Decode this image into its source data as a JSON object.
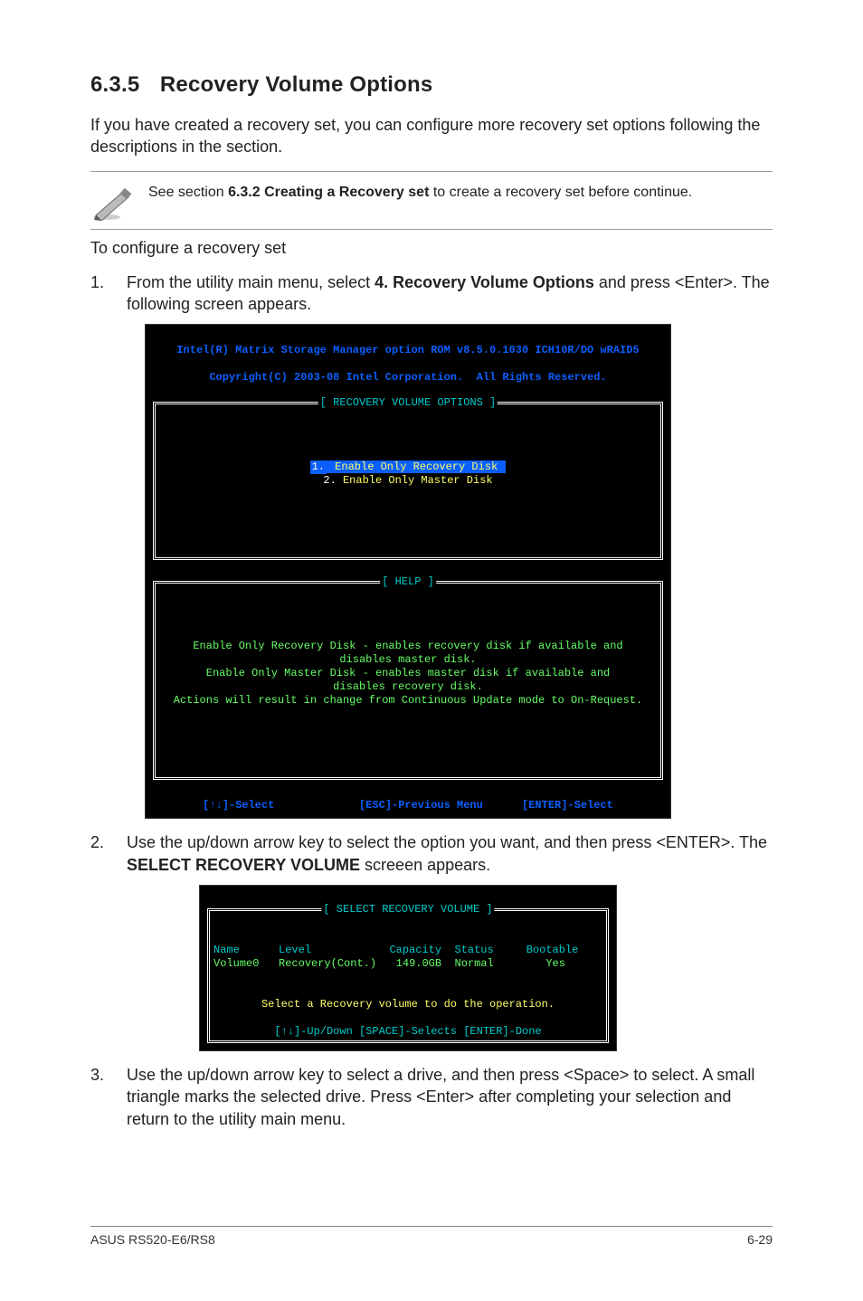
{
  "section": {
    "number": "6.3.5",
    "title": "Recovery Volume Options"
  },
  "intro": "If you have created a recovery set, you can configure more recovery set options following the descriptions in the section.",
  "note": {
    "pre": "See section ",
    "bold": "6.3.2 Creating a Recovery set",
    "post": " to create a recovery set before continue."
  },
  "after_note": "To configure a recovery set",
  "steps": {
    "s1": {
      "num": "1.",
      "pre": "From the utility main menu, select ",
      "bold": "4. Recovery Volume Options",
      "post": " and press <Enter>. The following screen appears."
    },
    "s2": {
      "num": "2.",
      "pre": "Use the up/down arrow key to select the option you want, and then press <ENTER>. The ",
      "bold": "SELECT RECOVERY VOLUME",
      "post": " screeen appears."
    },
    "s3": {
      "num": "3.",
      "text": "Use the up/down arrow key to select a drive, and then press <Space> to select. A small triangle marks the selected drive. Press <Enter> after completing your selection and return to the utility main menu."
    }
  },
  "term1": {
    "title1": "Intel(R) Matrix Storage Manager option ROM v8.5.0.1030 ICH10R/DO wRAID5",
    "title2": "Copyright(C) 2003-08 Intel Corporation.  All Rights Reserved.",
    "box1_title": "[ RECOVERY VOLUME OPTIONS ]",
    "opt1_num": "1.",
    "opt1_label": " Enable Only Recovery Disk ",
    "opt2_num": "2.",
    "opt2_label": " Enable Only Master Disk",
    "help_title": "[ HELP ]",
    "help_l1": "Enable Only Recovery Disk - enables recovery disk if available and",
    "help_l2": "disables master disk.",
    "help_l3": "Enable Only Master Disk - enables master disk if available and",
    "help_l4": "disables recovery disk.",
    "help_l5": "Actions will result in change from Continuous Update mode to On-Request.",
    "bottom_bar": "[↑↓]-Select             [ESC]-Previous Menu      [ENTER]-Select"
  },
  "term2": {
    "box_title": "[ SELECT RECOVERY VOLUME ]",
    "hdr_name": "Name",
    "hdr_level": "Level",
    "hdr_cap": "Capacity",
    "hdr_status": "Status",
    "hdr_boot": "Bootable",
    "row_name": "Volume0",
    "row_level": "Recovery(Cont.)",
    "row_cap": "149.0GB",
    "row_status": "Normal",
    "row_boot": "Yes",
    "msg": "Select a Recovery volume to do the operation.",
    "bottom": "[↑↓]-Up/Down [SPACE]-Selects [ENTER]-Done"
  },
  "footer": {
    "left": "ASUS RS520-E6/RS8",
    "right": "6-29"
  }
}
